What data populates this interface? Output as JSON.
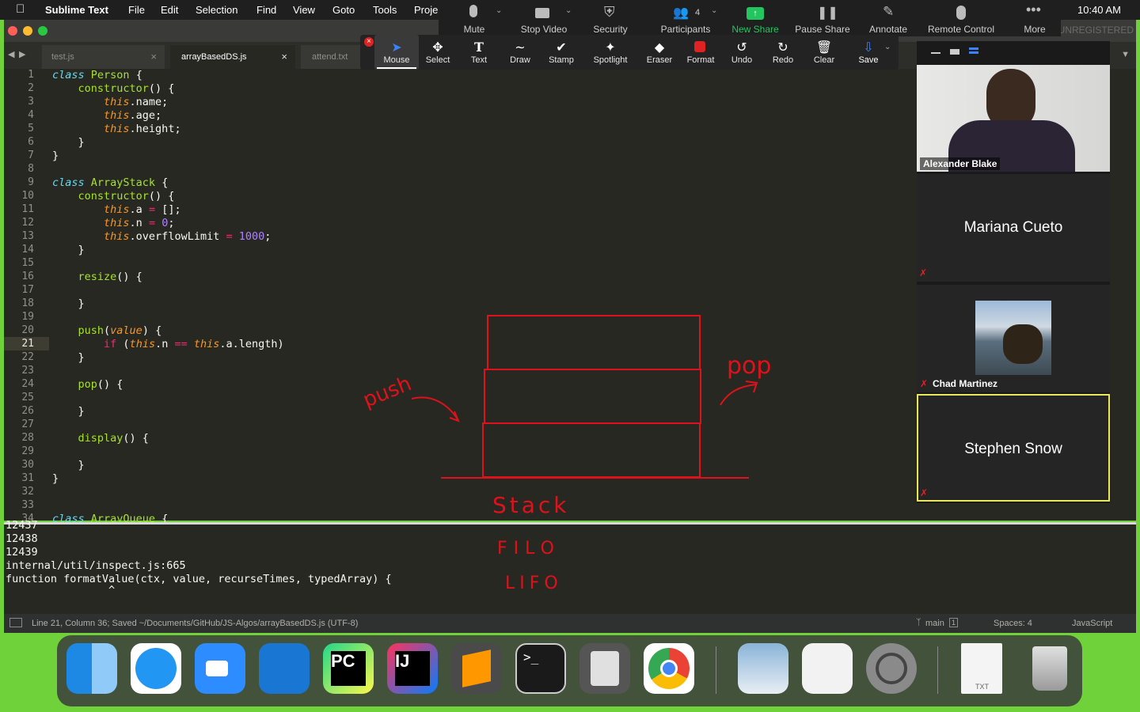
{
  "menubar": {
    "app": "Sublime Text",
    "items": [
      "File",
      "Edit",
      "Selection",
      "Find",
      "View",
      "Goto",
      "Tools",
      "Proje"
    ],
    "clock": "10:40 AM"
  },
  "zoom_toolbar": {
    "items": [
      {
        "label": "Mute",
        "icon": "microphone-icon"
      },
      {
        "label": "Stop Video",
        "icon": "video-camera-icon"
      },
      {
        "label": "Security",
        "icon": "shield-icon"
      },
      {
        "label": "Participants",
        "icon": "people-icon",
        "count": "4"
      },
      {
        "label": "New Share",
        "icon": "share-arrow-icon"
      },
      {
        "label": "Pause Share",
        "icon": "pause-icon"
      },
      {
        "label": "Annotate",
        "icon": "pencil-icon"
      },
      {
        "label": "Remote Control",
        "icon": "mouse-icon"
      },
      {
        "label": "More",
        "icon": "ellipsis-icon"
      }
    ],
    "unregistered": "UNREGISTERED"
  },
  "annotate_toolbar": {
    "tools": [
      {
        "label": "Mouse",
        "icon": "cursor-arrow-icon"
      },
      {
        "label": "Select",
        "icon": "move-icon"
      },
      {
        "label": "Text",
        "icon": "text-icon"
      },
      {
        "label": "Draw",
        "icon": "squiggle-icon"
      },
      {
        "label": "Stamp",
        "icon": "checkmark-icon"
      },
      {
        "label": "Spotlight",
        "icon": "wand-icon"
      },
      {
        "label": "Eraser",
        "icon": "eraser-icon"
      },
      {
        "label": "Format",
        "icon": "color-swatch-icon"
      },
      {
        "label": "Undo",
        "icon": "undo-icon"
      },
      {
        "label": "Redo",
        "icon": "redo-icon"
      },
      {
        "label": "Clear",
        "icon": "trash-icon"
      },
      {
        "label": "Save",
        "icon": "save-icon"
      }
    ]
  },
  "tabs": [
    {
      "label": "test.js"
    },
    {
      "label": "arrayBasedDS.js",
      "active": true
    },
    {
      "label": "attend.txt"
    }
  ],
  "code_lines": [
    "1",
    "2",
    "3",
    "4",
    "5",
    "6",
    "7",
    "8",
    "9",
    "10",
    "11",
    "12",
    "13",
    "14",
    "15",
    "16",
    "17",
    "18",
    "19",
    "20",
    "21",
    "22",
    "23",
    "24",
    "25",
    "26",
    "27",
    "28",
    "29",
    "30",
    "31",
    "32",
    "33",
    "34"
  ],
  "console": {
    "lines": [
      "12437",
      "12438",
      "12439",
      "internal/util/inspect.js:665",
      "function formatValue(ctx, value, recurseTimes, typedArray) {",
      "                ^"
    ]
  },
  "statusbar": {
    "left": "Line 21, Column 36; Saved ~/Documents/GitHub/JS-Algos/arrayBasedDS.js (UTF-8)",
    "branch": "main",
    "branch_count": "1",
    "spaces": "Spaces: 4",
    "syntax": "JavaScript"
  },
  "annotations": {
    "push": "push",
    "pop": "pop",
    "stack": "Stack",
    "filo": "FILO",
    "lifo": "LIFO"
  },
  "participants": [
    {
      "name": "Alexander Blake",
      "video": true
    },
    {
      "name": "Mariana Cueto",
      "muted": true
    },
    {
      "name": "Chad Martinez",
      "muted": true,
      "video": true
    },
    {
      "name": "Stephen Snow",
      "muted": true,
      "active": true
    }
  ],
  "dock": [
    {
      "name": "Finder"
    },
    {
      "name": "Safari"
    },
    {
      "name": "Zoom"
    },
    {
      "name": "Xcode"
    },
    {
      "name": "PyCharm",
      "text": "PC"
    },
    {
      "name": "IntelliJ",
      "text": "IJ"
    },
    {
      "name": "Sublime Text"
    },
    {
      "name": "Terminal",
      "text": ">_"
    },
    {
      "name": "Calculator"
    },
    {
      "name": "Chrome"
    },
    {
      "name": "Preview"
    },
    {
      "name": "System Information"
    },
    {
      "name": "System Preferences"
    },
    {
      "name": "TXT File",
      "text": "TXT"
    },
    {
      "name": "Trash"
    }
  ]
}
